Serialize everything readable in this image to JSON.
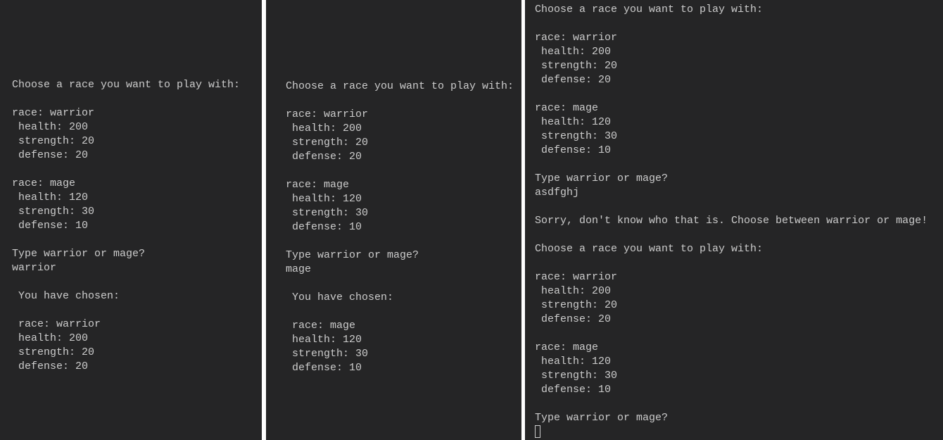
{
  "panels": [
    {
      "lines": [
        "Choose a race you want to play with:",
        "",
        "race: warrior",
        " health: 200",
        " strength: 20",
        " defense: 20",
        "",
        "race: mage",
        " health: 120",
        " strength: 30",
        " defense: 10",
        "",
        "Type warrior or mage?",
        "warrior",
        "",
        " You have chosen:",
        "",
        " race: warrior",
        " health: 200",
        " strength: 20",
        " defense: 20"
      ]
    },
    {
      "lines": [
        "Choose a race you want to play with:",
        "",
        "race: warrior",
        " health: 200",
        " strength: 20",
        " defense: 20",
        "",
        "race: mage",
        " health: 120",
        " strength: 30",
        " defense: 10",
        "",
        "Type warrior or mage?",
        "mage",
        "",
        " You have chosen:",
        "",
        " race: mage",
        " health: 120",
        " strength: 30",
        " defense: 10"
      ]
    },
    {
      "lines": [
        "Choose a race you want to play with:",
        "",
        "race: warrior",
        " health: 200",
        " strength: 20",
        " defense: 20",
        "",
        "race: mage",
        " health: 120",
        " strength: 30",
        " defense: 10",
        "",
        "Type warrior or mage?",
        "asdfghj",
        "",
        "Sorry, don't know who that is. Choose between warrior or mage!",
        "",
        "Choose a race you want to play with:",
        "",
        "race: warrior",
        " health: 200",
        " strength: 20",
        " defense: 20",
        "",
        "race: mage",
        " health: 120",
        " strength: 30",
        " defense: 10",
        "",
        "Type warrior or mage?"
      ]
    }
  ]
}
